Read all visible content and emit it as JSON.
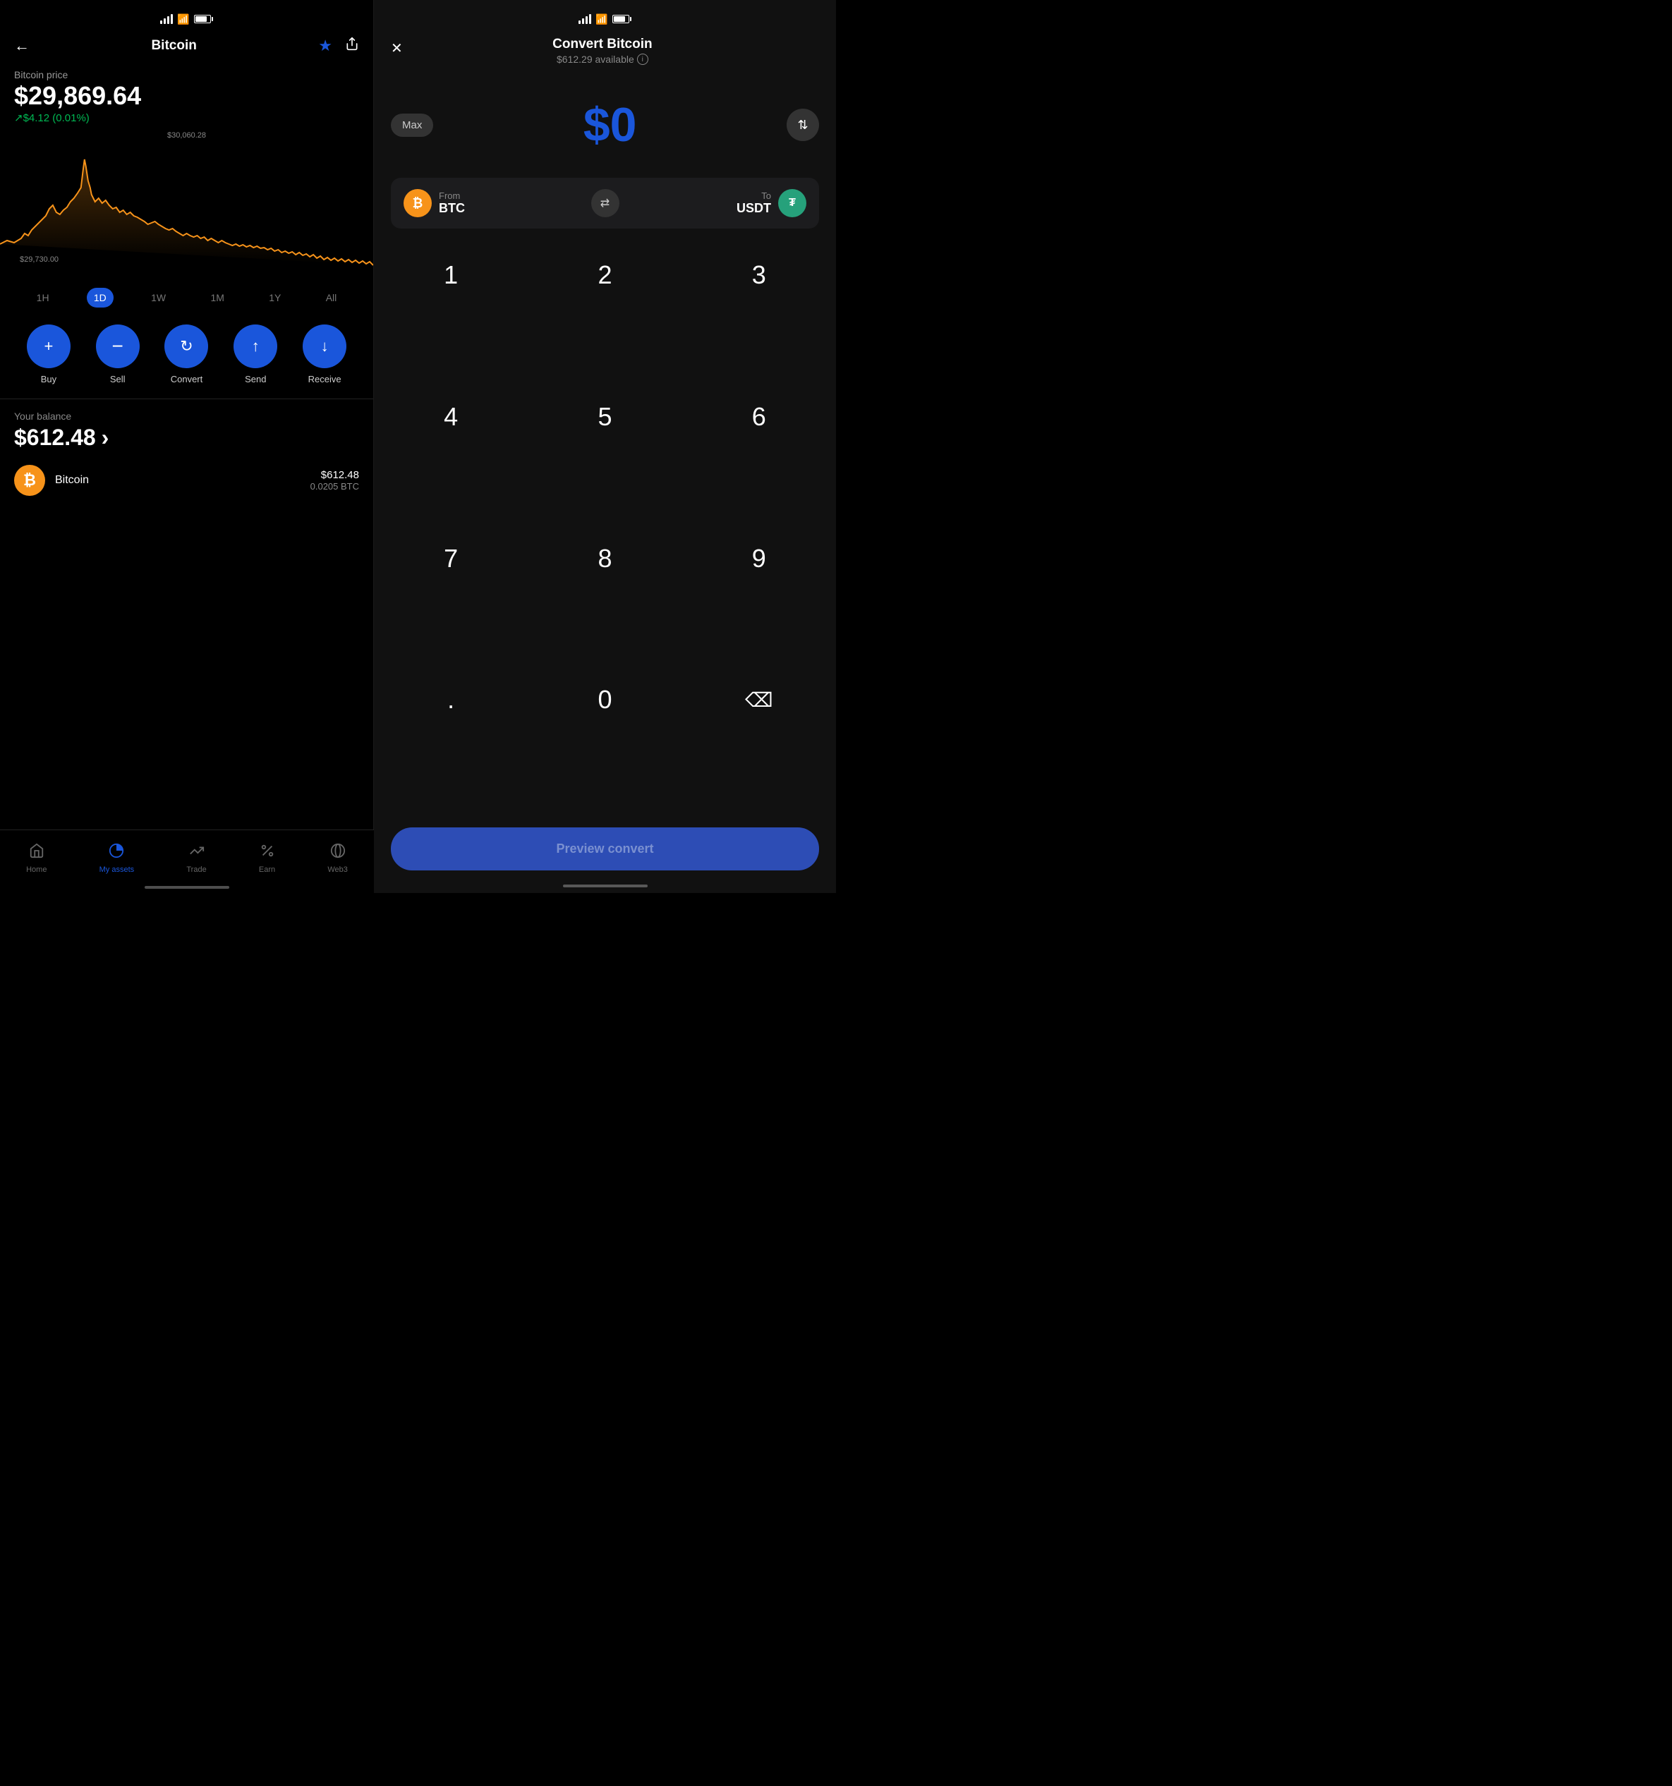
{
  "left": {
    "header": {
      "title": "Bitcoin",
      "back_label": "←",
      "star_label": "★",
      "share_label": "↑"
    },
    "price": {
      "label": "Bitcoin price",
      "value": "$29,869.64",
      "change": "↗$4.12 (0.01%)"
    },
    "chart": {
      "high": "$30,060.28",
      "low": "$29,730.00"
    },
    "timeFilters": [
      "1H",
      "1D",
      "1W",
      "1M",
      "1Y",
      "All"
    ],
    "activeFilter": "1D",
    "actions": [
      {
        "label": "Buy",
        "icon": "+"
      },
      {
        "label": "Sell",
        "icon": "−"
      },
      {
        "label": "Convert",
        "icon": "↻"
      },
      {
        "label": "Send",
        "icon": "↑"
      },
      {
        "label": "Receive",
        "icon": "↓"
      }
    ],
    "balance": {
      "label": "Your balance",
      "value": "$612.48"
    },
    "asset": {
      "name": "Bitcoin",
      "usd": "$612.48",
      "btc": "0.0205 BTC"
    },
    "nav": [
      {
        "label": "Home",
        "icon": "⌂",
        "active": false
      },
      {
        "label": "My assets",
        "icon": "◕",
        "active": true
      },
      {
        "label": "Trade",
        "icon": "↗",
        "active": false
      },
      {
        "label": "Earn",
        "icon": "%",
        "active": false
      },
      {
        "label": "Web3",
        "icon": "◎",
        "active": false
      }
    ]
  },
  "right": {
    "header": {
      "title": "Convert Bitcoin",
      "available": "$612.29 available",
      "close": "✕"
    },
    "amount": {
      "value": "$0",
      "max_label": "Max"
    },
    "from": {
      "label": "From",
      "currency": "BTC"
    },
    "to": {
      "label": "To",
      "currency": "USDT"
    },
    "numpad": [
      "1",
      "2",
      "3",
      "4",
      "5",
      "6",
      "7",
      "8",
      "9",
      ".",
      "0",
      "⌫"
    ],
    "preview_btn": "Preview convert"
  }
}
